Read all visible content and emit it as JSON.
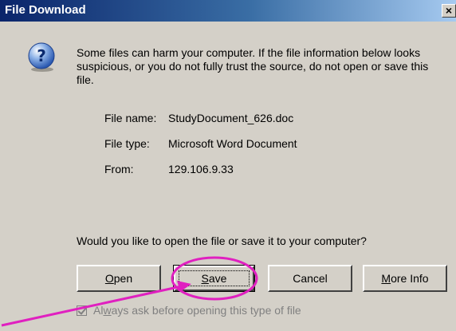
{
  "window": {
    "title": "File Download",
    "close_glyph": "×"
  },
  "dialog": {
    "icon": "question-icon",
    "message": "Some files can harm your computer. If the file information below looks suspicious, or you do not fully trust the source, do not open or save this file.",
    "fields": [
      {
        "label": "File name:",
        "value": "StudyDocument_626.doc"
      },
      {
        "label": "File type:",
        "value": "Microsoft Word Document"
      },
      {
        "label": "From:",
        "value": "129.106.9.33"
      }
    ],
    "question": "Would you like to open the file or save it to your computer?",
    "buttons": {
      "open_prefix": "",
      "open_mnemonic": "O",
      "open_rest": "pen",
      "save_prefix": "",
      "save_mnemonic": "S",
      "save_rest": "ave",
      "cancel": "Cancel",
      "more_prefix": "",
      "more_mnemonic": "M",
      "more_rest": "ore Info"
    },
    "checkbox": {
      "prefix": "Al",
      "mnemonic": "w",
      "rest": "ays ask before opening this type of file",
      "checked": true
    }
  },
  "annotation": {
    "color": "#e020c0"
  }
}
